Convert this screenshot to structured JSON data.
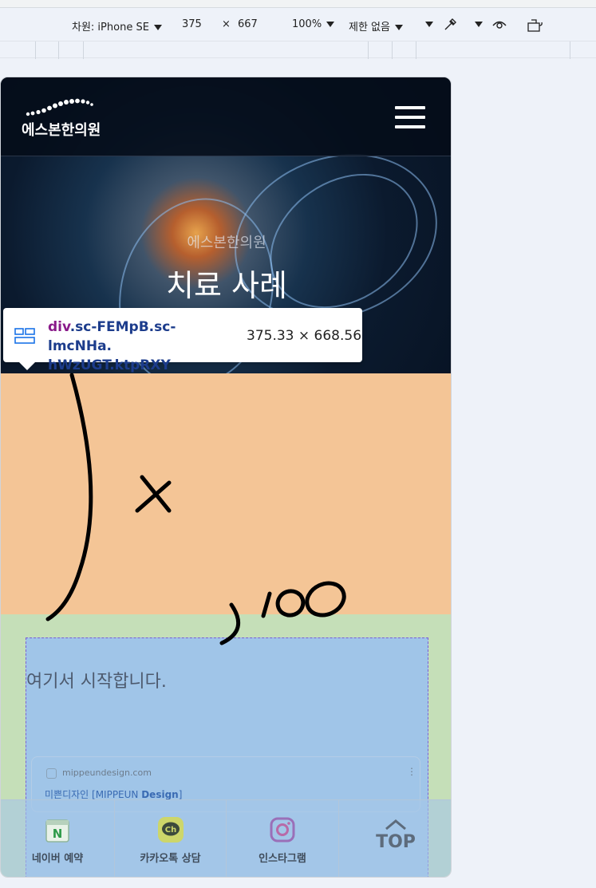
{
  "devtools": {
    "device_label": "차원: iPhone SE",
    "width": "375",
    "times": "×",
    "height": "667",
    "zoom": "100%",
    "throttle": "제한 없음"
  },
  "site": {
    "logo_text": "에스본한의원",
    "hero_subtitle": "에스본한의원",
    "hero_title": "치료 사례"
  },
  "tooltip": {
    "tag": "div",
    "classes_line1": ".sc-FEMpB.sc-lmcNHa.",
    "classes_line2": "hWzUGT.ktpRXY",
    "size": "375.33 × 668.56"
  },
  "content": {
    "start_text": "여기서 시작합니다.",
    "card_domain": "mippeundesign.com",
    "card_menu": "⋮",
    "card_title_prefix": "미쁜디자인 [MIPPEUN ",
    "card_title_bold": "Design",
    "card_title_suffix": "]"
  },
  "bottom_nav": {
    "naver": "네이버 예약",
    "kakao": "카카오톡 상담",
    "instagram": "인스타그램",
    "top": "TOP"
  },
  "annotation": {
    "x_mark": "x",
    "plus_100": ")100"
  },
  "colors": {
    "orange_box": "#f4c596",
    "green_box": "#c5dfb8",
    "blue_box": "#a0c5e8",
    "dashed_outline": "#7b5ed6"
  }
}
